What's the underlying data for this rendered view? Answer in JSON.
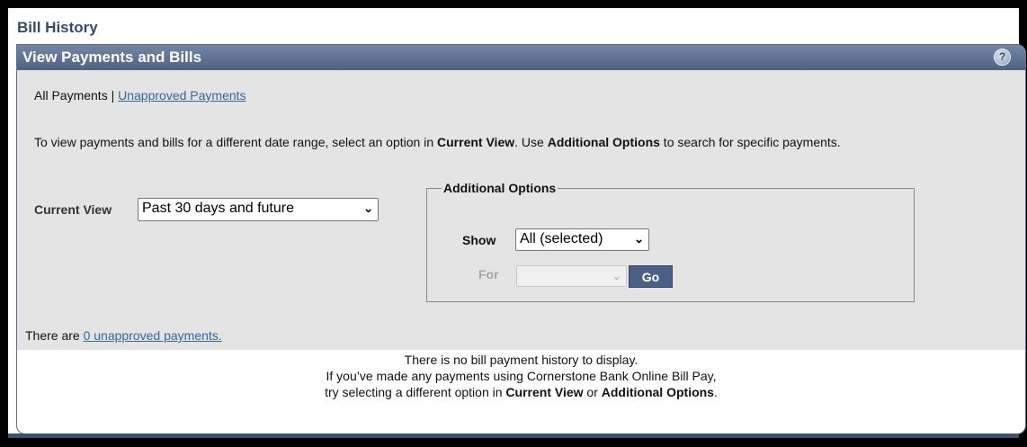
{
  "page": {
    "title": "Bill History"
  },
  "panel": {
    "title": "View Payments and Bills",
    "help_icon": "?"
  },
  "tabs": {
    "all_payments": "All Payments",
    "separator": "|",
    "unapproved_payments": "Unapproved Payments"
  },
  "intro": {
    "part1": "To view payments and bills for a different date range, select an option in ",
    "current_view": "Current View",
    "part2": ". Use ",
    "additional_options": "Additional Options",
    "part3": " to search for specific payments."
  },
  "current_view": {
    "label": "Current View",
    "selected": "Past 30 days and future"
  },
  "additional_options": {
    "legend": "Additional Options",
    "show_label": "Show",
    "show_selected": "All (selected)",
    "for_label": "For",
    "for_selected": "",
    "go_label": "Go"
  },
  "unapproved": {
    "prefix": "There are ",
    "link": "0 unapproved payments."
  },
  "empty": {
    "line1": "There is no bill payment history to display.",
    "line2": "If you’ve made any payments using Cornerstone Bank Online Bill Pay,",
    "line3_prefix": "try selecting a different option in ",
    "line3_current_view": "Current View",
    "line3_or": " or ",
    "line3_additional": "Additional Options",
    "line3_end": "."
  },
  "colors": {
    "header": "#4e6284",
    "link": "#336699",
    "panel_bg": "#e4e4e4"
  }
}
